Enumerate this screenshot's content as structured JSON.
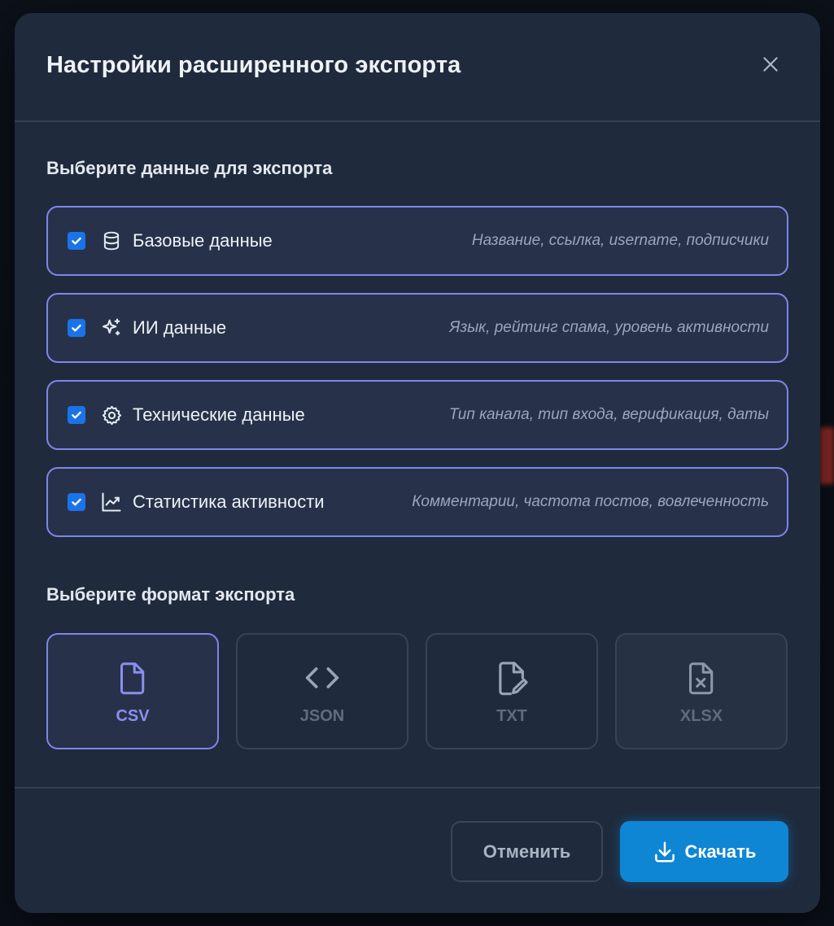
{
  "modal": {
    "title": "Настройки расширенного экспорта",
    "close_icon": "close-icon"
  },
  "data_section": {
    "title": "Выберите данные для экспорта",
    "options": [
      {
        "label": "Базовые данные",
        "description": "Название, ссылка, username, подписчики",
        "icon": "database-icon",
        "checked": true
      },
      {
        "label": "ИИ данные",
        "description": "Язык, рейтинг спама, уровень активности",
        "icon": "sparkles-icon",
        "checked": true
      },
      {
        "label": "Технические данные",
        "description": "Тип канала, тип входа, верификация, даты",
        "icon": "gear-icon",
        "checked": true
      },
      {
        "label": "Статистика активности",
        "description": "Комментарии, частота постов, вовлеченность",
        "icon": "line-chart-icon",
        "checked": true
      }
    ]
  },
  "format_section": {
    "title": "Выберите формат экспорта",
    "formats": [
      {
        "label": "CSV",
        "icon": "file-icon",
        "selected": true
      },
      {
        "label": "JSON",
        "icon": "code-icon",
        "selected": false
      },
      {
        "label": "TXT",
        "icon": "file-pen-icon",
        "selected": false
      },
      {
        "label": "XLSX",
        "icon": "file-x-icon",
        "selected": false,
        "disabled": true
      }
    ]
  },
  "footer": {
    "cancel_label": "Отменить",
    "download_label": "Скачать",
    "download_icon": "download-icon"
  },
  "colors": {
    "accent": "#7f86e8",
    "primary_button": "#0e86d4",
    "checkbox": "#1a73e8",
    "modal_bg": "#1f2a3c"
  }
}
